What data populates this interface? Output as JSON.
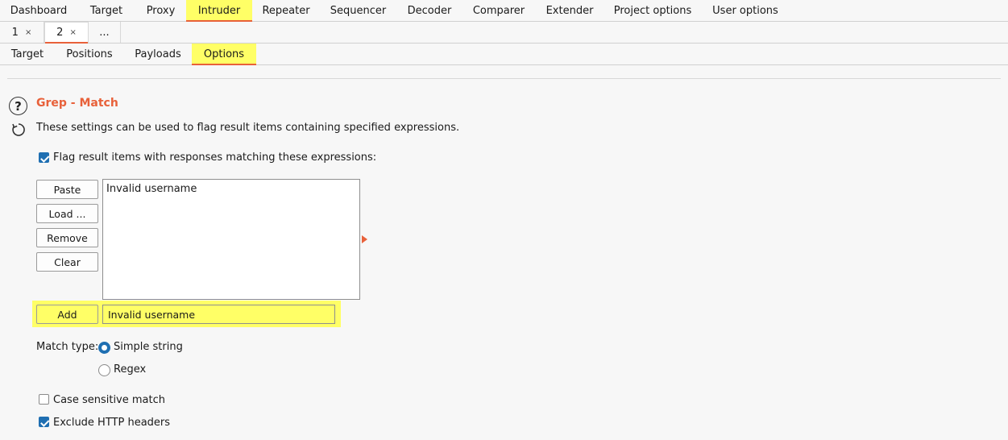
{
  "main_tabs": [
    "Dashboard",
    "Target",
    "Proxy",
    "Intruder",
    "Repeater",
    "Sequencer",
    "Decoder",
    "Comparer",
    "Extender",
    "Project options",
    "User options"
  ],
  "attack_tabs": [
    {
      "label": "1",
      "close": "×"
    },
    {
      "label": "2",
      "close": "×"
    },
    {
      "label": "...",
      "close": ""
    }
  ],
  "intruder_tabs": [
    "Target",
    "Positions",
    "Payloads",
    "Options"
  ],
  "section": {
    "title": "Grep - Match",
    "description": "These settings can be used to flag result items containing specified expressions."
  },
  "flag_checkbox": {
    "label": "Flag result items with responses matching these expressions:",
    "checked": true
  },
  "buttons": {
    "paste": "Paste",
    "load": "Load ...",
    "remove": "Remove",
    "clear": "Clear",
    "add": "Add"
  },
  "expressions": [
    "Invalid username"
  ],
  "add_input_value": "Invalid username",
  "match_type": {
    "label": "Match type:",
    "options": [
      "Simple string",
      "Regex"
    ],
    "selected": "Simple string"
  },
  "case_sensitive": {
    "label": "Case sensitive match",
    "checked": false
  },
  "exclude_headers": {
    "label": "Exclude HTTP headers",
    "checked": true
  },
  "colors": {
    "accent": "#e8613a",
    "highlight": "#ffff66",
    "check": "#1f6fb2"
  }
}
